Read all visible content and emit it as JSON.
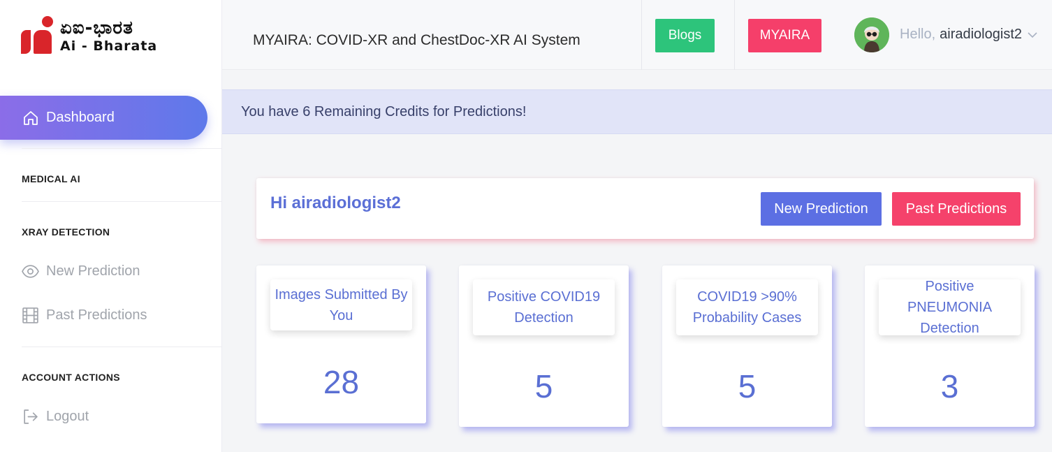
{
  "logo": {
    "native": "ಏಐ-ಭಾರತ",
    "latin": "Ai - Bharata"
  },
  "sidebar": {
    "active": {
      "label": "Dashboard",
      "icon": "home-icon"
    },
    "sections": [
      {
        "title": "MEDICAL AI"
      },
      {
        "title": "XRAY DETECTION",
        "items": [
          {
            "label": "New Prediction",
            "icon": "eye-icon"
          },
          {
            "label": "Past Predictions",
            "icon": "film-icon"
          }
        ]
      },
      {
        "title": "ACCOUNT ACTIONS",
        "items": [
          {
            "label": "Logout",
            "icon": "logout-icon"
          }
        ]
      }
    ]
  },
  "header": {
    "title": "MYAIRA: COVID-XR and ChestDoc-XR AI System",
    "blogs_label": "Blogs",
    "myaira_label": "MYAIRA",
    "greeting_prefix": "Hello,",
    "username": "airadiologist2"
  },
  "alert": {
    "text": "You have 6 Remaining Credits for Predictions!"
  },
  "welcome": {
    "title": "Hi airadiologist2",
    "new_prediction_label": "New Prediction",
    "past_predictions_label": "Past Predictions"
  },
  "stats": [
    {
      "label": "Images Submitted By You",
      "value": "28"
    },
    {
      "label": "Positive COVID19 Detection",
      "value": "5"
    },
    {
      "label": "COVID19 >90% Probability Cases",
      "value": "5"
    },
    {
      "label": "Positive PNEUMONIA Detection",
      "value": "3"
    }
  ],
  "colors": {
    "accent_blue": "#5c6fe3",
    "accent_pink": "#f5426b",
    "green": "#2dc47b",
    "gradient_start": "#8b6de8",
    "gradient_end": "#5e79ea"
  }
}
